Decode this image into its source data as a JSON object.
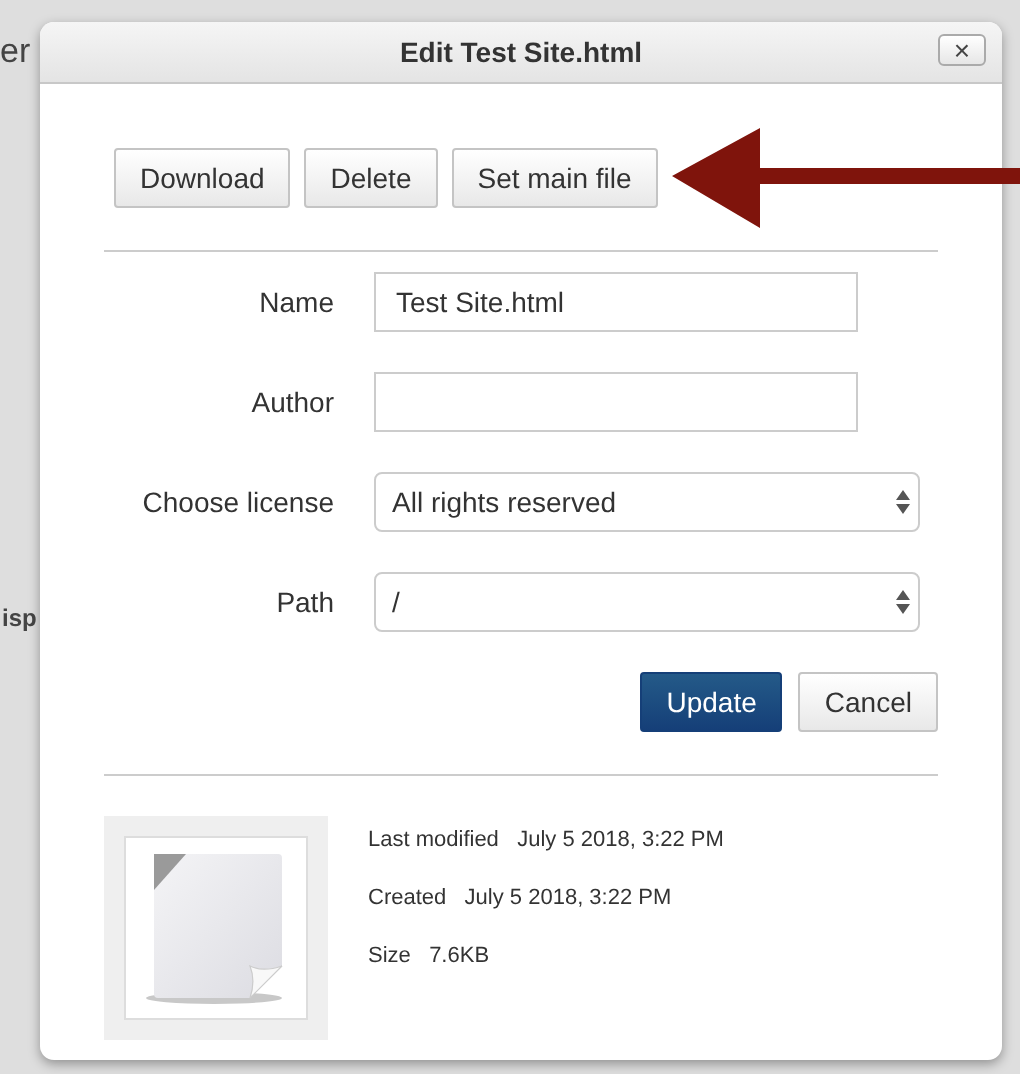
{
  "background": {
    "fragments": [
      "er",
      "isp"
    ]
  },
  "dialog": {
    "title": "Edit Test Site.html",
    "close": "×",
    "actions": [
      "Download",
      "Delete",
      "Set main file"
    ],
    "fields": [
      {
        "kind": "text",
        "label": "Name",
        "value": "Test Site.html"
      },
      {
        "kind": "text",
        "label": "Author"
      },
      {
        "kind": "select",
        "label": "Choose license",
        "value": "All rights reserved"
      },
      {
        "kind": "select",
        "label": "Path",
        "value": "/"
      }
    ],
    "buttons": [
      {
        "label": "Update",
        "primary": true
      },
      {
        "label": "Cancel",
        "primary": false
      }
    ],
    "info": [
      {
        "label": "Last modified",
        "value": "July 5 2018, 3:22 PM"
      },
      {
        "label": "Created",
        "value": "July 5 2018, 3:22 PM"
      },
      {
        "label": "Size",
        "value": "7.6KB"
      }
    ]
  }
}
